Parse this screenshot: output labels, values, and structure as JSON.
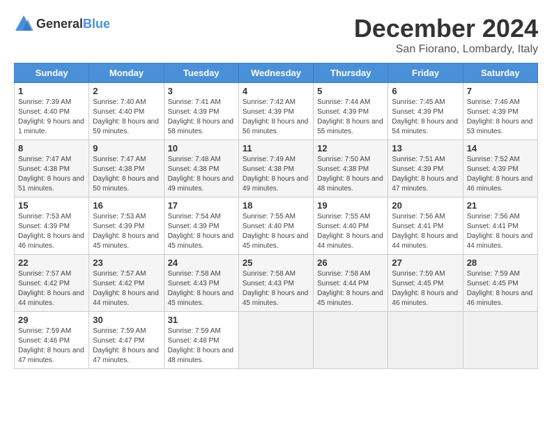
{
  "logo": {
    "general": "General",
    "blue": "Blue"
  },
  "header": {
    "month": "December 2024",
    "location": "San Fiorano, Lombardy, Italy"
  },
  "weekdays": [
    "Sunday",
    "Monday",
    "Tuesday",
    "Wednesday",
    "Thursday",
    "Friday",
    "Saturday"
  ],
  "weeks": [
    [
      {
        "day": "1",
        "info": "Sunrise: 7:39 AM\nSunset: 4:40 PM\nDaylight: 9 hours and 1 minute."
      },
      {
        "day": "2",
        "info": "Sunrise: 7:40 AM\nSunset: 4:40 PM\nDaylight: 8 hours and 59 minutes."
      },
      {
        "day": "3",
        "info": "Sunrise: 7:41 AM\nSunset: 4:39 PM\nDaylight: 8 hours and 58 minutes."
      },
      {
        "day": "4",
        "info": "Sunrise: 7:42 AM\nSunset: 4:39 PM\nDaylight: 8 hours and 56 minutes."
      },
      {
        "day": "5",
        "info": "Sunrise: 7:44 AM\nSunset: 4:39 PM\nDaylight: 8 hours and 55 minutes."
      },
      {
        "day": "6",
        "info": "Sunrise: 7:45 AM\nSunset: 4:39 PM\nDaylight: 8 hours and 54 minutes."
      },
      {
        "day": "7",
        "info": "Sunrise: 7:46 AM\nSunset: 4:39 PM\nDaylight: 8 hours and 53 minutes."
      }
    ],
    [
      {
        "day": "8",
        "info": "Sunrise: 7:47 AM\nSunset: 4:38 PM\nDaylight: 8 hours and 51 minutes."
      },
      {
        "day": "9",
        "info": "Sunrise: 7:47 AM\nSunset: 4:38 PM\nDaylight: 8 hours and 50 minutes."
      },
      {
        "day": "10",
        "info": "Sunrise: 7:48 AM\nSunset: 4:38 PM\nDaylight: 8 hours and 49 minutes."
      },
      {
        "day": "11",
        "info": "Sunrise: 7:49 AM\nSunset: 4:38 PM\nDaylight: 8 hours and 49 minutes."
      },
      {
        "day": "12",
        "info": "Sunrise: 7:50 AM\nSunset: 4:38 PM\nDaylight: 8 hours and 48 minutes."
      },
      {
        "day": "13",
        "info": "Sunrise: 7:51 AM\nSunset: 4:39 PM\nDaylight: 8 hours and 47 minutes."
      },
      {
        "day": "14",
        "info": "Sunrise: 7:52 AM\nSunset: 4:39 PM\nDaylight: 8 hours and 46 minutes."
      }
    ],
    [
      {
        "day": "15",
        "info": "Sunrise: 7:53 AM\nSunset: 4:39 PM\nDaylight: 8 hours and 46 minutes."
      },
      {
        "day": "16",
        "info": "Sunrise: 7:53 AM\nSunset: 4:39 PM\nDaylight: 8 hours and 45 minutes."
      },
      {
        "day": "17",
        "info": "Sunrise: 7:54 AM\nSunset: 4:39 PM\nDaylight: 8 hours and 45 minutes."
      },
      {
        "day": "18",
        "info": "Sunrise: 7:55 AM\nSunset: 4:40 PM\nDaylight: 8 hours and 45 minutes."
      },
      {
        "day": "19",
        "info": "Sunrise: 7:55 AM\nSunset: 4:40 PM\nDaylight: 8 hours and 44 minutes."
      },
      {
        "day": "20",
        "info": "Sunrise: 7:56 AM\nSunset: 4:41 PM\nDaylight: 8 hours and 44 minutes."
      },
      {
        "day": "21",
        "info": "Sunrise: 7:56 AM\nSunset: 4:41 PM\nDaylight: 8 hours and 44 minutes."
      }
    ],
    [
      {
        "day": "22",
        "info": "Sunrise: 7:57 AM\nSunset: 4:42 PM\nDaylight: 8 hours and 44 minutes."
      },
      {
        "day": "23",
        "info": "Sunrise: 7:57 AM\nSunset: 4:42 PM\nDaylight: 8 hours and 44 minutes."
      },
      {
        "day": "24",
        "info": "Sunrise: 7:58 AM\nSunset: 4:43 PM\nDaylight: 8 hours and 45 minutes."
      },
      {
        "day": "25",
        "info": "Sunrise: 7:58 AM\nSunset: 4:43 PM\nDaylight: 8 hours and 45 minutes."
      },
      {
        "day": "26",
        "info": "Sunrise: 7:58 AM\nSunset: 4:44 PM\nDaylight: 8 hours and 45 minutes."
      },
      {
        "day": "27",
        "info": "Sunrise: 7:59 AM\nSunset: 4:45 PM\nDaylight: 8 hours and 46 minutes."
      },
      {
        "day": "28",
        "info": "Sunrise: 7:59 AM\nSunset: 4:45 PM\nDaylight: 8 hours and 46 minutes."
      }
    ],
    [
      {
        "day": "29",
        "info": "Sunrise: 7:59 AM\nSunset: 4:46 PM\nDaylight: 8 hours and 47 minutes."
      },
      {
        "day": "30",
        "info": "Sunrise: 7:59 AM\nSunset: 4:47 PM\nDaylight: 8 hours and 47 minutes."
      },
      {
        "day": "31",
        "info": "Sunrise: 7:59 AM\nSunset: 4:48 PM\nDaylight: 8 hours and 48 minutes."
      },
      {
        "day": "",
        "info": ""
      },
      {
        "day": "",
        "info": ""
      },
      {
        "day": "",
        "info": ""
      },
      {
        "day": "",
        "info": ""
      }
    ]
  ]
}
